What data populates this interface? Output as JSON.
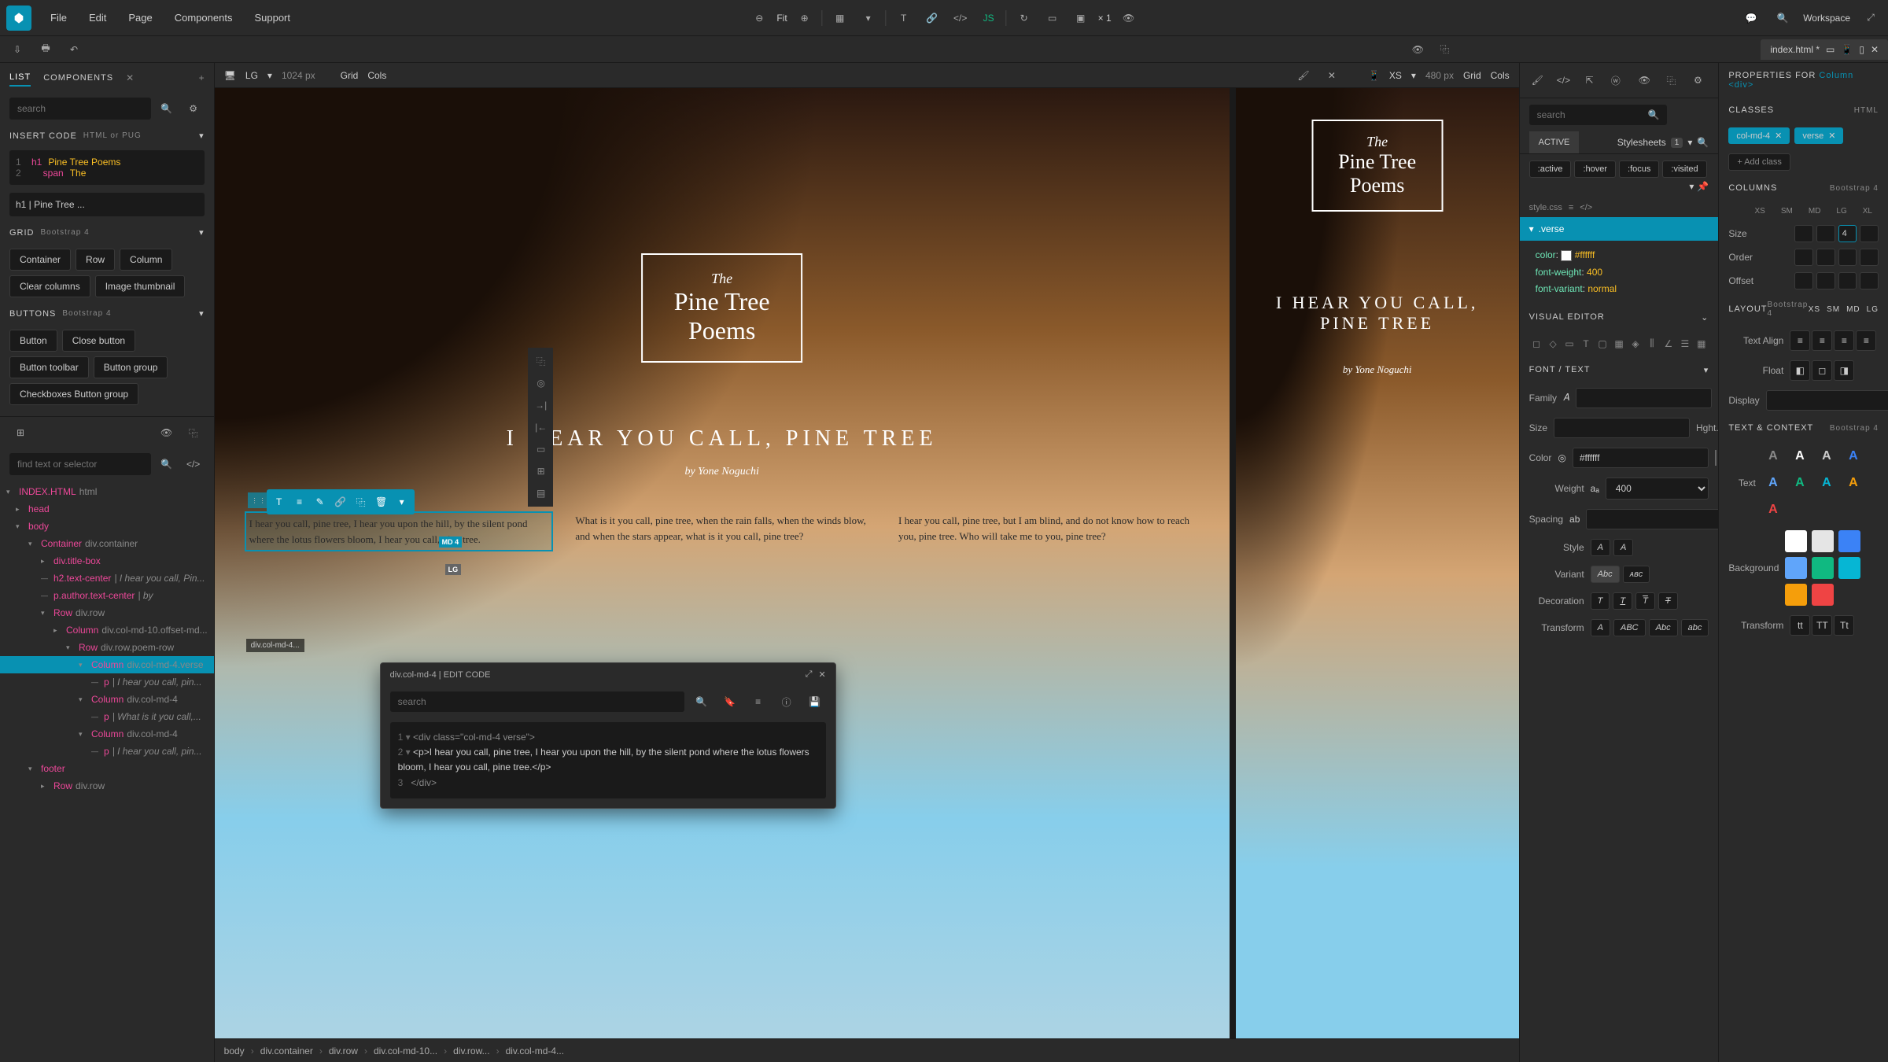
{
  "menu": {
    "file": "File",
    "edit": "Edit",
    "page": "Page",
    "components": "Components",
    "support": "Support"
  },
  "top": {
    "fit": "Fit",
    "zoom_mult": "× 1",
    "workspace": "Workspace"
  },
  "file_tab": {
    "name": "index.html *"
  },
  "left": {
    "tabs": {
      "list": "LIST",
      "components": "COMPONENTS"
    },
    "search_ph": "search",
    "insert_code": "INSERT CODE",
    "insert_sub": "HTML or PUG",
    "code_l1_tag": "h1",
    "code_l1_txt": "Pine Tree Poems",
    "code_l2_tag": "span",
    "code_l2_txt": "The",
    "label_input": "h1 | Pine Tree ...",
    "grid_title": "GRID",
    "grid_sub": "Bootstrap 4",
    "grid_btns": [
      "Container",
      "Row",
      "Column",
      "Clear columns",
      "Image thumbnail"
    ],
    "buttons_title": "BUTTONS",
    "buttons_sub": "Bootstrap 4",
    "button_btns": [
      "Button",
      "Close button",
      "Button toolbar",
      "Button group",
      "Checkboxes Button group"
    ],
    "tree_search_ph": "find text or selector"
  },
  "tree": [
    {
      "ind": 0,
      "chev": "▾",
      "tag": "INDEX.HTML",
      "cls": "html"
    },
    {
      "ind": 1,
      "chev": "▸",
      "tag": "head"
    },
    {
      "ind": 1,
      "chev": "▾",
      "tag": "body"
    },
    {
      "ind": 2,
      "chev": "▾",
      "tag": "Container",
      "cls": "div.container"
    },
    {
      "ind": 3,
      "chev": "▸",
      "tag": "div.title-box"
    },
    {
      "ind": 3,
      "chev": "—",
      "tag": "h2.text-center",
      "txt": "| I hear you call, Pin..."
    },
    {
      "ind": 3,
      "chev": "—",
      "tag": "p.author.text-center",
      "txt": "| by"
    },
    {
      "ind": 3,
      "chev": "▾",
      "tag": "Row",
      "cls": "div.row"
    },
    {
      "ind": 4,
      "chev": "▸",
      "tag": "Column",
      "cls": "div.col-md-10.offset-md..."
    },
    {
      "ind": 5,
      "chev": "▾",
      "tag": "Row",
      "cls": "div.row.poem-row"
    },
    {
      "ind": 6,
      "chev": "▾",
      "tag": "Column",
      "cls": "div.col-md-4.verse",
      "sel": true
    },
    {
      "ind": 7,
      "chev": "—",
      "tag": "p",
      "txt": "| I hear you call, pin..."
    },
    {
      "ind": 6,
      "chev": "▾",
      "tag": "Column",
      "cls": "div.col-md-4"
    },
    {
      "ind": 7,
      "chev": "—",
      "tag": "p",
      "txt": "| What is it you call,..."
    },
    {
      "ind": 6,
      "chev": "▾",
      "tag": "Column",
      "cls": "div.col-md-4"
    },
    {
      "ind": 7,
      "chev": "—",
      "tag": "p",
      "txt": "| I hear you call, pin..."
    },
    {
      "ind": 2,
      "chev": "▾",
      "tag": "footer"
    },
    {
      "ind": 3,
      "chev": "▸",
      "tag": "Row",
      "cls": "div.row"
    }
  ],
  "viewport": {
    "lg_label": "LG",
    "lg_px": "1024 px",
    "grid": "Grid",
    "cols": "Cols",
    "xs_label": "XS",
    "xs_px": "480 px",
    "the": "The",
    "title": "Pine Tree\nPoems",
    "poem_title": "I HEAR YOU CALL, PINE TREE",
    "author": "by Yone Noguchi",
    "v1": "I hear you call, pine tree, I hear you upon the hill, by the silent pond where the lotus flowers bloom, I hear you call, pine tree.",
    "v2": "What is it you call, pine tree, when the rain falls, when the winds blow, and when the stars appear, what is it you call, pine tree?",
    "v3": "I hear you call, pine tree, but I am blind, and do not know how to reach you, pine tree. Who will take me to you, pine tree?",
    "sel_label": "div.col-md-4...",
    "badge_md": "MD 4",
    "badge_lg": "LG"
  },
  "popup": {
    "title": "div.col-md-4 | EDIT CODE",
    "search_ph": "search",
    "line1": "<div class=\"col-md-4 verse\">",
    "line2": "    <p>I hear you call, pine tree, I hear you upon the hill, by the silent pond where the lotus flowers bloom, I hear you call, pine tree.</p>",
    "line3": "</div>"
  },
  "style_panel": {
    "search_ph": "search",
    "active": "ACTIVE",
    "stylesheets": "Stylesheets",
    "pseudos": [
      ":active",
      ":hover",
      ":focus",
      ":visited"
    ],
    "src": "style.css",
    "selector": ".verse",
    "props": [
      {
        "n": "color",
        "v": "#ffffff"
      },
      {
        "n": "font-weight",
        "v": "400"
      },
      {
        "n": "font-variant",
        "v": "normal"
      }
    ],
    "visual_editor": "VISUAL EDITOR",
    "font_text": "FONT / TEXT",
    "family": "Family",
    "size": "Size",
    "hght": "Hght.",
    "color": "Color",
    "color_val": "#ffffff",
    "weight": "Weight",
    "weight_val": "400",
    "spacing": "Spacing",
    "style": "Style",
    "variant": "Variant",
    "decoration": "Decoration",
    "transform": "Transform",
    "variant_abc": "Abc",
    "variant_sc": "ᴀʙᴄ"
  },
  "props_panel": {
    "title": "PROPERTIES FOR",
    "target": "Column <div>",
    "classes": "CLASSES",
    "classes_sub": "HTML",
    "pills": [
      "col-md-4",
      "verse"
    ],
    "add": "+ Add class",
    "columns": "COLUMNS",
    "columns_sub": "Bootstrap 4",
    "bp": [
      "XS",
      "SM",
      "MD",
      "LG",
      "XL"
    ],
    "size": "Size",
    "size_val": "4",
    "order": "Order",
    "offset": "Offset",
    "layout": "LAYOUT",
    "layout_sub": "Bootstrap 4",
    "layout_bp": [
      "XS",
      "SM",
      "MD",
      "LG"
    ],
    "text_align": "Text Align",
    "float": "Float",
    "display": "Display",
    "text_ctx": "TEXT & CONTEXT",
    "text_ctx_sub": "Bootstrap 4",
    "text": "Text",
    "background": "Background",
    "transform2": "Transform"
  },
  "breadcrumb": [
    "body",
    "div.container",
    "div.row",
    "div.col-md-10...",
    "div.row...",
    "div.col-md-4..."
  ]
}
